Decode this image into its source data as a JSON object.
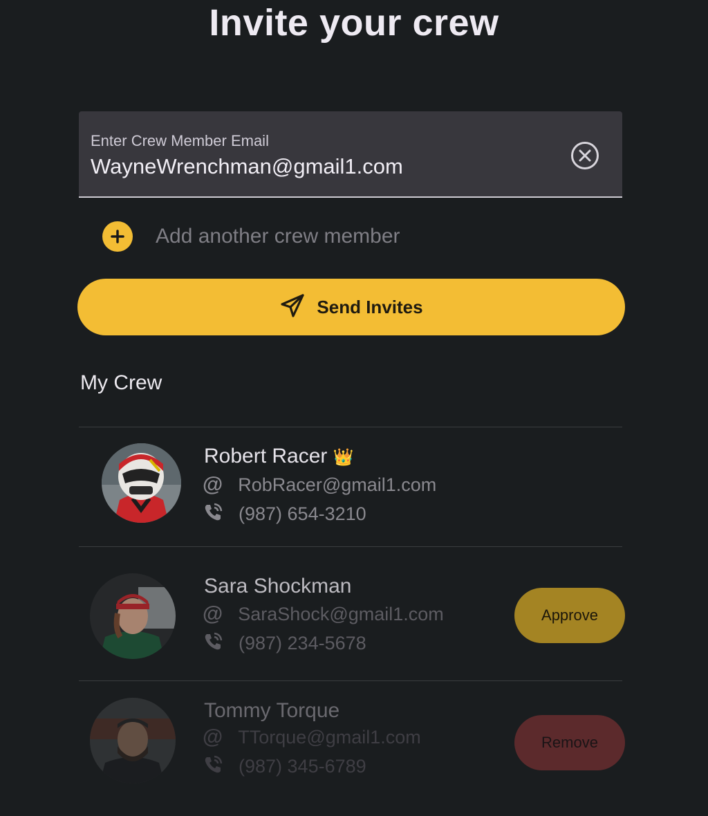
{
  "header": {
    "title": "Invite your crew"
  },
  "invite_form": {
    "email_label": "Enter Crew Member Email",
    "email_value": "WayneWrenchman@gmail1.com",
    "add_another_label": "Add another crew member",
    "send_label": "Send Invites"
  },
  "crew": {
    "title": "My Crew",
    "members": [
      {
        "name": "Robert Racer",
        "badge": "👑",
        "email": "RobRacer@gmail1.com",
        "phone": "(987) 654-3210",
        "action": ""
      },
      {
        "name": "Sara Shockman",
        "email": "SaraShock@gmail1.com",
        "phone": "(987) 234-5678",
        "action": "Approve"
      },
      {
        "name": "Tommy Torque",
        "email": "TTorque@gmail1.com",
        "phone": "(987) 345-6789",
        "action": "Remove"
      }
    ]
  },
  "colors": {
    "background": "#1a1d1f",
    "accent": "#f3bd34",
    "field_background": "#38373d",
    "approve_pill": "#a48423",
    "remove_pill": "#5c2a2c"
  }
}
